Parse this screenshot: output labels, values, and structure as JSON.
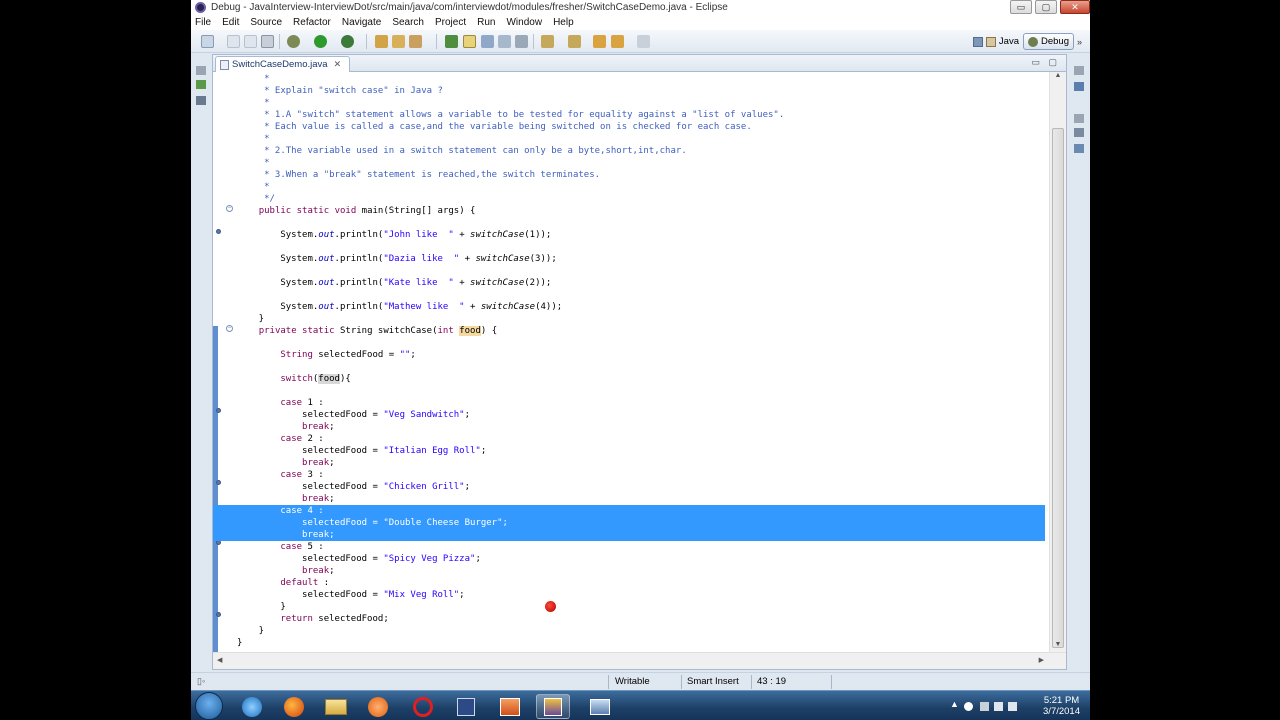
{
  "window": {
    "title": "Debug - JavaInterview-InterviewDot/src/main/java/com/interviewdot/modules/fresher/SwitchCaseDemo.java - Eclipse",
    "buttons": {
      "minimize": "▭",
      "maximize": "▢",
      "close": "✕"
    }
  },
  "menubar": {
    "items": [
      "File",
      "Edit",
      "Source",
      "Refactor",
      "Navigate",
      "Search",
      "Project",
      "Run",
      "Window",
      "Help"
    ]
  },
  "perspectives": {
    "java_label": "Java",
    "debug_label": "Debug",
    "more": "»"
  },
  "editor": {
    "tab_label": "SwitchCaseDemo.java",
    "tab_close": "✕",
    "minmax": "▭ ▢",
    "code": [
      "     *",
      "     * Explain \"switch case\" in Java ?",
      "     *",
      "     * 1.A \"switch\" statement allows a variable to be tested for equality against a \"list of values\".",
      "     * Each value is called a case,and the variable being switched on is checked for each case.",
      "     *",
      "     * 2.The variable used in a switch statement can only be a byte,short,int,char.",
      "     *",
      "     * 3.When a \"break\" statement is reached,the switch terminates.",
      "     *",
      "     */",
      "    public static void main(String[] args) {",
      "",
      "        System.out.println(\"John like  \" + switchCase(1));",
      "",
      "        System.out.println(\"Dazia like  \" + switchCase(3));",
      "",
      "        System.out.println(\"Kate like  \" + switchCase(2));",
      "",
      "        System.out.println(\"Mathew like  \" + switchCase(4));",
      "    }",
      "    private static String switchCase(int food) {",
      "",
      "        String selectedFood = \"\";",
      "",
      "        switch(food){",
      "",
      "        case 1 :",
      "            selectedFood = \"Veg Sandwitch\";",
      "            break;",
      "        case 2 :",
      "            selectedFood = \"Italian Egg Roll\";",
      "            break;",
      "        case 3 :",
      "            selectedFood = \"Chicken Grill\";",
      "            break;",
      "        case 4 :",
      "            selectedFood = \"Double Cheese Burger\";",
      "            break;",
      "        case 5 :",
      "            selectedFood = \"Spicy Veg Pizza\";",
      "            break;",
      "        default :",
      "            selectedFood = \"Mix Veg Roll\";",
      "        }",
      "        return selectedFood;",
      "    }",
      "}"
    ],
    "selected_lines": [
      36,
      37,
      38
    ]
  },
  "statusbar": {
    "writable": "Writable",
    "insert_mode": "Smart Insert",
    "position": "43 : 19"
  },
  "taskbar": {
    "clock_time": "5:21 PM",
    "clock_date": "3/7/2014"
  }
}
